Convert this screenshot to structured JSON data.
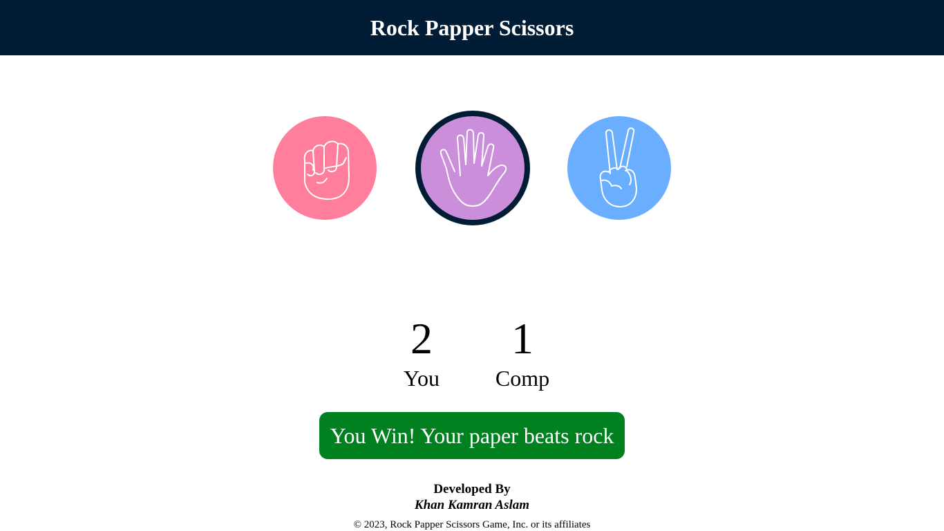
{
  "header": {
    "title": "Rock Papper Scissors",
    "background": "#001d35"
  },
  "choices": [
    {
      "name": "rock",
      "icon": "fist-icon",
      "color": "#ff7e9c",
      "selected": false
    },
    {
      "name": "paper",
      "icon": "open-hand-icon",
      "color": "#cb8edb",
      "selected": true
    },
    {
      "name": "scissors",
      "icon": "peace-hand-icon",
      "color": "#6aaeff",
      "selected": false
    }
  ],
  "selected_border_color": "#001d35",
  "scores": {
    "user": {
      "value": "2",
      "label": "You"
    },
    "comp": {
      "value": "1",
      "label": "Comp"
    }
  },
  "message": {
    "text": "You Win! Your paper beats rock",
    "color": "#00801f"
  },
  "footer": {
    "developed_by": "Developed By",
    "author": "Khan Kamran Aslam",
    "copyright": "© 2023, Rock Papper Scissors Game, Inc. or its affiliates"
  }
}
